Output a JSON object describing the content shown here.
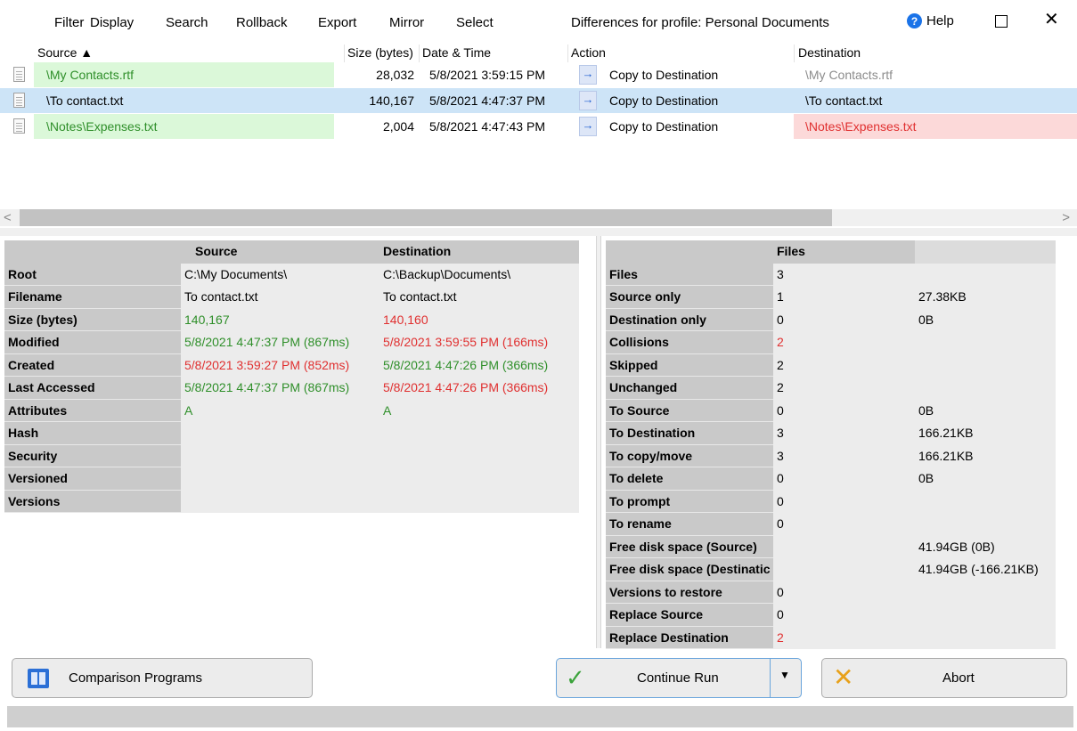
{
  "menu": {
    "items": [
      {
        "label": "Filter"
      },
      {
        "label": "Display"
      },
      {
        "label": "Search"
      },
      {
        "label": "Rollback"
      },
      {
        "label": "Export"
      },
      {
        "label": "Mirror"
      },
      {
        "label": "Select"
      }
    ],
    "title": "Differences for profile: Personal Documents",
    "help_label": "Help",
    "help_icon": "help-icon",
    "close_glyph": "✕"
  },
  "filelist": {
    "columns": {
      "source": "Source ▲",
      "size": "Size (bytes)",
      "datetime": "Date & Time",
      "action": "Action",
      "destination": "Destination"
    },
    "rows": [
      {
        "source": "\\My Contacts.rtf",
        "size": "28,032",
        "datetime": "5/8/2021 3:59:15 PM",
        "action": "Copy to Destination",
        "destination": "\\My Contacts.rtf"
      },
      {
        "source": "\\To contact.txt",
        "size": "140,167",
        "datetime": "5/8/2021 4:47:37 PM",
        "action": "Copy to Destination",
        "destination": "\\To contact.txt"
      },
      {
        "source": "\\Notes\\Expenses.txt",
        "size": "2,004",
        "datetime": "5/8/2021 4:47:43 PM",
        "action": "Copy to Destination",
        "destination": "\\Notes\\Expenses.txt"
      }
    ],
    "scroll_left": "<",
    "scroll_right": ">"
  },
  "compare": {
    "headers": {
      "source": "Source",
      "destination": "Destination"
    },
    "rows": [
      {
        "label": "Root",
        "source": "C:\\My Documents\\",
        "destination": "C:\\Backup\\Documents\\"
      },
      {
        "label": "Filename",
        "source": "To contact.txt",
        "destination": "To contact.txt"
      },
      {
        "label": "Size (bytes)",
        "source": "140,167",
        "destination": "140,160"
      },
      {
        "label": "Modified",
        "source": "5/8/2021 4:47:37 PM (867ms)",
        "destination": "5/8/2021 3:59:55 PM (166ms)"
      },
      {
        "label": "Created",
        "source": "5/8/2021 3:59:27 PM (852ms)",
        "destination": "5/8/2021 4:47:26 PM (366ms)"
      },
      {
        "label": "Last Accessed",
        "source": "5/8/2021 4:47:37 PM (867ms)",
        "destination": "5/8/2021 4:47:26 PM (366ms)"
      },
      {
        "label": "Attributes",
        "source": "A",
        "destination": "A"
      },
      {
        "label": "Hash",
        "source": "",
        "destination": ""
      },
      {
        "label": "Security",
        "source": "",
        "destination": ""
      },
      {
        "label": "Versioned",
        "source": "",
        "destination": ""
      },
      {
        "label": "Versions",
        "source": "",
        "destination": ""
      }
    ]
  },
  "stats": {
    "header": "Files",
    "rows": [
      {
        "label": "Files",
        "count": "3",
        "size": ""
      },
      {
        "label": "Source only",
        "count": "1",
        "size": "27.38KB"
      },
      {
        "label": "Destination only",
        "count": "0",
        "size": "0B"
      },
      {
        "label": "Collisions",
        "count": "2",
        "size": ""
      },
      {
        "label": "Skipped",
        "count": "2",
        "size": ""
      },
      {
        "label": "Unchanged",
        "count": "2",
        "size": ""
      },
      {
        "label": "To Source",
        "count": "0",
        "size": "0B"
      },
      {
        "label": "To Destination",
        "count": "3",
        "size": "166.21KB"
      },
      {
        "label": "To copy/move",
        "count": "3",
        "size": "166.21KB"
      },
      {
        "label": "To delete",
        "count": "0",
        "size": "0B"
      },
      {
        "label": "To prompt",
        "count": "0",
        "size": ""
      },
      {
        "label": "To rename",
        "count": "0",
        "size": ""
      },
      {
        "label": "Free disk space (Source)",
        "count": "",
        "size": "41.94GB (0B)"
      },
      {
        "label": "Free disk space (Destinatic",
        "count": "",
        "size": "41.94GB (-166.21KB)"
      },
      {
        "label": "Versions to restore",
        "count": "0",
        "size": ""
      },
      {
        "label": "Replace Source",
        "count": "0",
        "size": ""
      },
      {
        "label": "Replace Destination",
        "count": "2",
        "size": ""
      }
    ]
  },
  "buttons": {
    "compare": "Comparison Programs",
    "continue": "Continue Run",
    "abort": "Abort"
  },
  "colors": {
    "selected_row": "#cde4f7",
    "source_new": "#dbf8d9",
    "dest_conflict": "#fcd9d9",
    "green_text": "#2f8f2a",
    "red_text": "#e03030"
  }
}
